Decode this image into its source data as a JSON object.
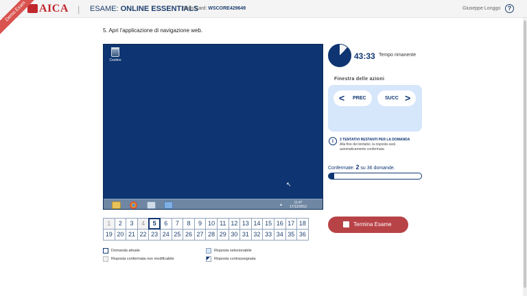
{
  "header": {
    "ribbon": "Demo Exam",
    "logo": "AICA",
    "separator": "|",
    "exam_prefix": "ESAME: ",
    "exam_name": "ONLINE ESSENTIALS",
    "skills_label": "Skills Card: ",
    "skills_code": "WSCORE429649",
    "user": "Giuseppe Longgo",
    "help": "?"
  },
  "question": "5. Apri l'applicazione di navigazione web.",
  "desktop": {
    "bin_label": "Cestino",
    "tray_time": "11:47",
    "tray_date": "17/12/2012",
    "tray_arrow": "▲"
  },
  "timer": {
    "value": "43:33",
    "label": "Tempo rimanente",
    "remaining_fraction": 0.88
  },
  "actions": {
    "title": "Finestra delle azioni",
    "prev_label": "PREC",
    "next_label": "SUCC"
  },
  "info": {
    "title": "3 TENTATIVI RESTANTI PER LA DOMANDA",
    "line1": "Alla fine dei tentativi, la risposta sarà",
    "line2": "automaticamente confermata"
  },
  "confirmed": {
    "prefix": "Confermate: ",
    "count": "2",
    "suffix": " su 36 domande.",
    "fraction": 0.056
  },
  "finish_label": "Termina Esame",
  "questions": [
    [
      "1",
      "2",
      "3",
      "4",
      "5",
      "6",
      "7",
      "8",
      "9",
      "10",
      "11",
      "12",
      "13",
      "14",
      "15",
      "16",
      "17",
      "18"
    ],
    [
      "19",
      "20",
      "21",
      "22",
      "23",
      "24",
      "25",
      "26",
      "27",
      "28",
      "29",
      "30",
      "31",
      "32",
      "33",
      "34",
      "35",
      "36"
    ]
  ],
  "question_states": {
    "current": "5",
    "confirmed": [
      "1",
      "4"
    ]
  },
  "legend": {
    "current": "Domanda attuale",
    "confirmed": "Risposta confermata non modificabile",
    "selected": "Risposta selezionabile",
    "flagged": "Risposta contrassegnata"
  },
  "colors": {
    "primary": "#0e3572",
    "accent": "#c0282d",
    "finish": "#b84347",
    "panel": "#d6e6fb"
  }
}
